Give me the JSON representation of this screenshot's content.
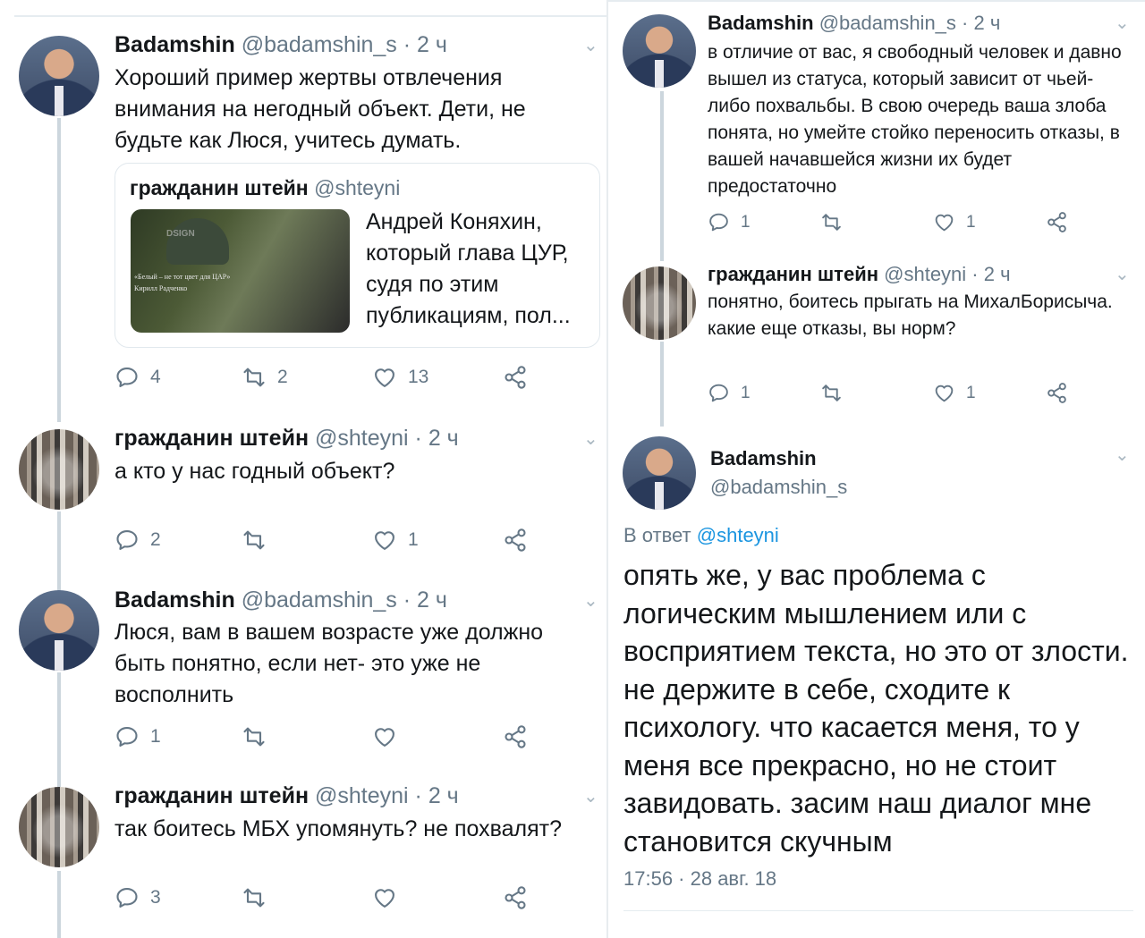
{
  "left": {
    "tweets": [
      {
        "name": "Badamshin",
        "handle": "@badamshin_s",
        "sep_time": " · 2 ч",
        "text": "Хороший пример жертвы отвлечения внимания на негодный объект. Дети, не будьте как Люся, учитесь думать.",
        "quote": {
          "name": "гражданин штейн",
          "handle": "@shteyni",
          "text": "Андрей Коняхин, который глава ЦУР, судя по этим публикациям, пол...",
          "thumb_caption_1": "«Белый – не тот цвет для ЦАР»",
          "thumb_caption_2": "Кирилл Радченко",
          "thumb_mark": "DSIGN"
        },
        "replies": "4",
        "retweets": "2",
        "likes": "13"
      },
      {
        "name": "гражданин штейн",
        "handle": "@shteyni",
        "sep_time": " · 2 ч",
        "text": "а кто у нас годный объект?",
        "replies": "2",
        "retweets": "",
        "likes": "1"
      },
      {
        "name": "Badamshin",
        "handle": "@badamshin_s",
        "sep_time": " · 2 ч",
        "text": "Люся, вам в вашем возрасте уже должно быть понятно, если нет- это уже не восполнить",
        "replies": "1",
        "retweets": "",
        "likes": ""
      },
      {
        "name": "гражданин штейн",
        "handle": "@shteyni",
        "sep_time": " · 2 ч",
        "text": "так боитесь МБХ упомянуть? не похвалят?",
        "replies": "3",
        "retweets": "",
        "likes": ""
      }
    ]
  },
  "right": {
    "tweets": [
      {
        "name": "Badamshin",
        "handle": "@badamshin_s",
        "sep_time": " · 2 ч",
        "text": "в отличие от вас, я свободный человек и давно вышел из статуса, который зависит от чьей-либо похвальбы. В свою очередь ваша злоба понята, но умейте стойко переносить отказы, в вашей начавшейся жизни их будет предостаточно",
        "replies": "1",
        "retweets": "",
        "likes": "1"
      },
      {
        "name": "гражданин штейн",
        "handle": "@shteyni",
        "sep_time": " · 2 ч",
        "text": "понятно, боитесь прыгать на МихалБорисыча. какие еще отказы, вы норм?",
        "replies": "1",
        "retweets": "",
        "likes": "1"
      }
    ],
    "main": {
      "name": "Badamshin",
      "handle": "@badamshin_s",
      "reply_prefix": "В ответ",
      "reply_handle": "@shteyni",
      "text": "опять же, у вас проблема с логическим мышлением или с восприятием текста, но это от злости. не держите в себе, сходите к психологу. что касается меня, то у меня все прекрасно, но не стоит завидовать. засим наш диалог мне становится скучным",
      "timestamp": "17:56 · 28 авг. 18"
    }
  },
  "icons": {
    "reply": "reply-icon",
    "retweet": "retweet-icon",
    "like": "heart-icon",
    "share": "share-icon",
    "more": "chevron-down-icon"
  },
  "colors": {
    "text": "#14171a",
    "secondary": "#657786",
    "link": "#1b95e0",
    "thread_line": "#ccd6dd",
    "border": "#e1e8ed"
  }
}
